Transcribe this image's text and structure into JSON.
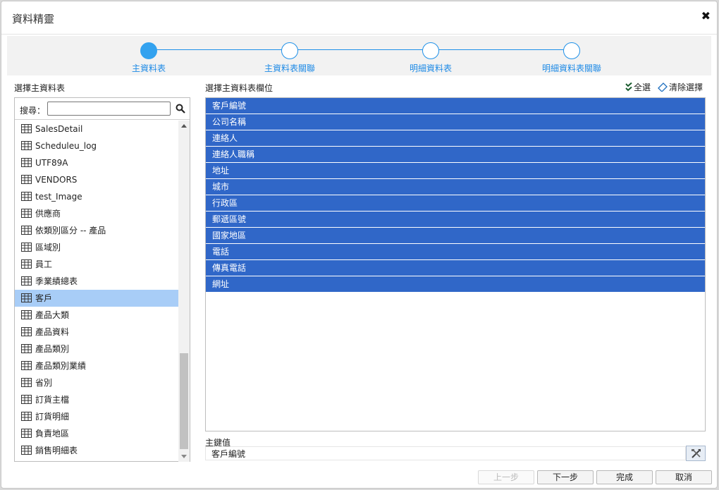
{
  "dialog": {
    "title": "資料精靈",
    "close_icon": "close-icon"
  },
  "wizard": {
    "steps": [
      {
        "label": "主資料表",
        "active": true
      },
      {
        "label": "主資料表關聯",
        "active": false
      },
      {
        "label": "明細資料表",
        "active": false
      },
      {
        "label": "明細資料表關聯",
        "active": false
      }
    ],
    "accent": "#1e90e8"
  },
  "left": {
    "title": "選擇主資料表",
    "search": {
      "label": "搜尋：",
      "value": "",
      "placeholder": ""
    },
    "tables": [
      "SalesDetail",
      "Scheduleu_log",
      "UTF89A",
      "VENDORS",
      "test_Image",
      "供應商",
      "依類別區分 -- 產品",
      "區域別",
      "員工",
      "季業績總表",
      "客戶",
      "產品大類",
      "產品資料",
      "產品類別",
      "產品類別業績",
      "省別",
      "訂貨主檔",
      "訂貨明細",
      "負責地區",
      "銷售明細表"
    ],
    "selected_table": "客戶"
  },
  "right": {
    "title": "選擇主資料表欄位",
    "select_all_label": "全選",
    "clear_selection_label": "清除選擇",
    "fields": [
      "客戶編號",
      "公司名稱",
      "連絡人",
      "連絡人職稱",
      "地址",
      "城市",
      "行政區",
      "郵遞區號",
      "國家地區",
      "電話",
      "傳真電話",
      "網址"
    ],
    "field_color": "#3067c8"
  },
  "primary_key": {
    "label": "主鍵值",
    "value": "客戶編號"
  },
  "buttons": {
    "prev": "上一步",
    "next": "下一步",
    "finish": "完成",
    "cancel": "取消"
  }
}
